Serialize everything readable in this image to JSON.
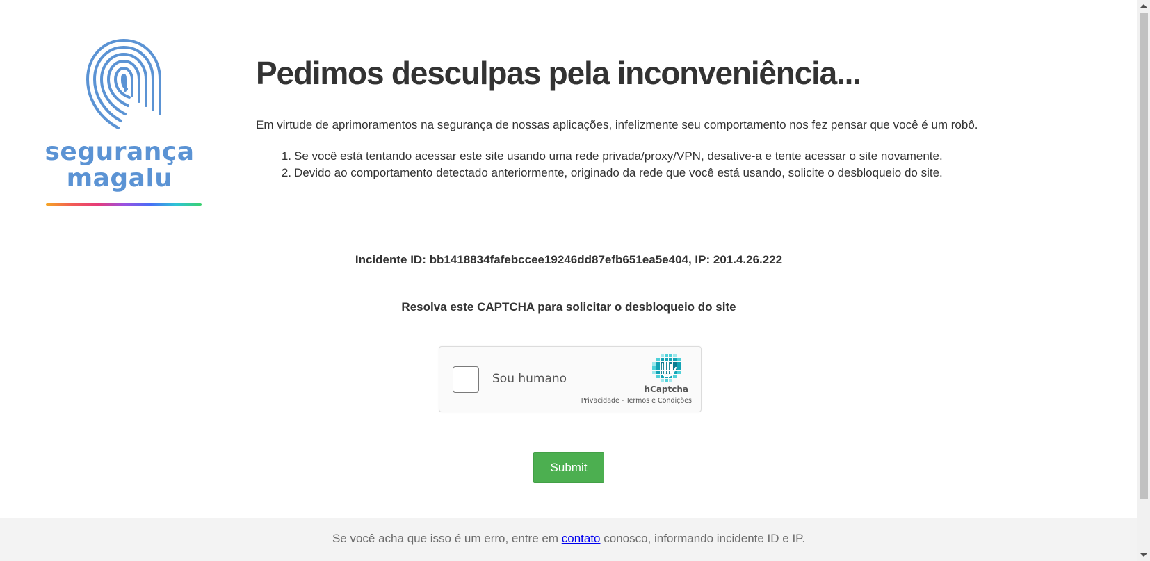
{
  "logo": {
    "line1": "segurança",
    "line2": "magalu"
  },
  "main": {
    "title": "Pedimos desculpas pela inconveniência...",
    "intro": "Em virtude de aprimoramentos na segurança de nossas aplicações, infelizmente seu comportamento nos fez pensar que você é um robô.",
    "steps": [
      {
        "num": "1.",
        "text": "Se você está tentando acessar este site usando uma rede privada/proxy/VPN, desative-a e tente acessar o site novamente."
      },
      {
        "num": "2.",
        "text": "Devido ao comportamento detectado anteriormente, originado da rede que você está usando, solicite o desbloqueio do site."
      }
    ],
    "incident": "Incidente ID: bb1418834fafebccee19246dd87efb651ea5e404, IP: 201.4.26.222",
    "captcha_prompt": "Resolva este CAPTCHA para solicitar o desbloqueio do site"
  },
  "captcha": {
    "checkbox_label": "Sou humano",
    "brand": "hCaptcha",
    "privacy": "Privacidade",
    "separator": " - ",
    "terms": "Termos e Condições",
    "checked": false,
    "logo_colors": [
      "#0a7a8f",
      "#13a3b5",
      "#4fd1d9",
      "#9de8ec"
    ]
  },
  "form": {
    "submit_label": "Submit",
    "submit_color": "#4caf50"
  },
  "footer": {
    "before": "Se você acha que isso é um erro, entre em ",
    "link": "contato",
    "after": " conosco, informando incidente ID e IP."
  },
  "colors": {
    "logo_blue": "#5b93d4",
    "text": "#333333",
    "footer_bg": "#f3f3f3",
    "link": "#0000ee"
  }
}
